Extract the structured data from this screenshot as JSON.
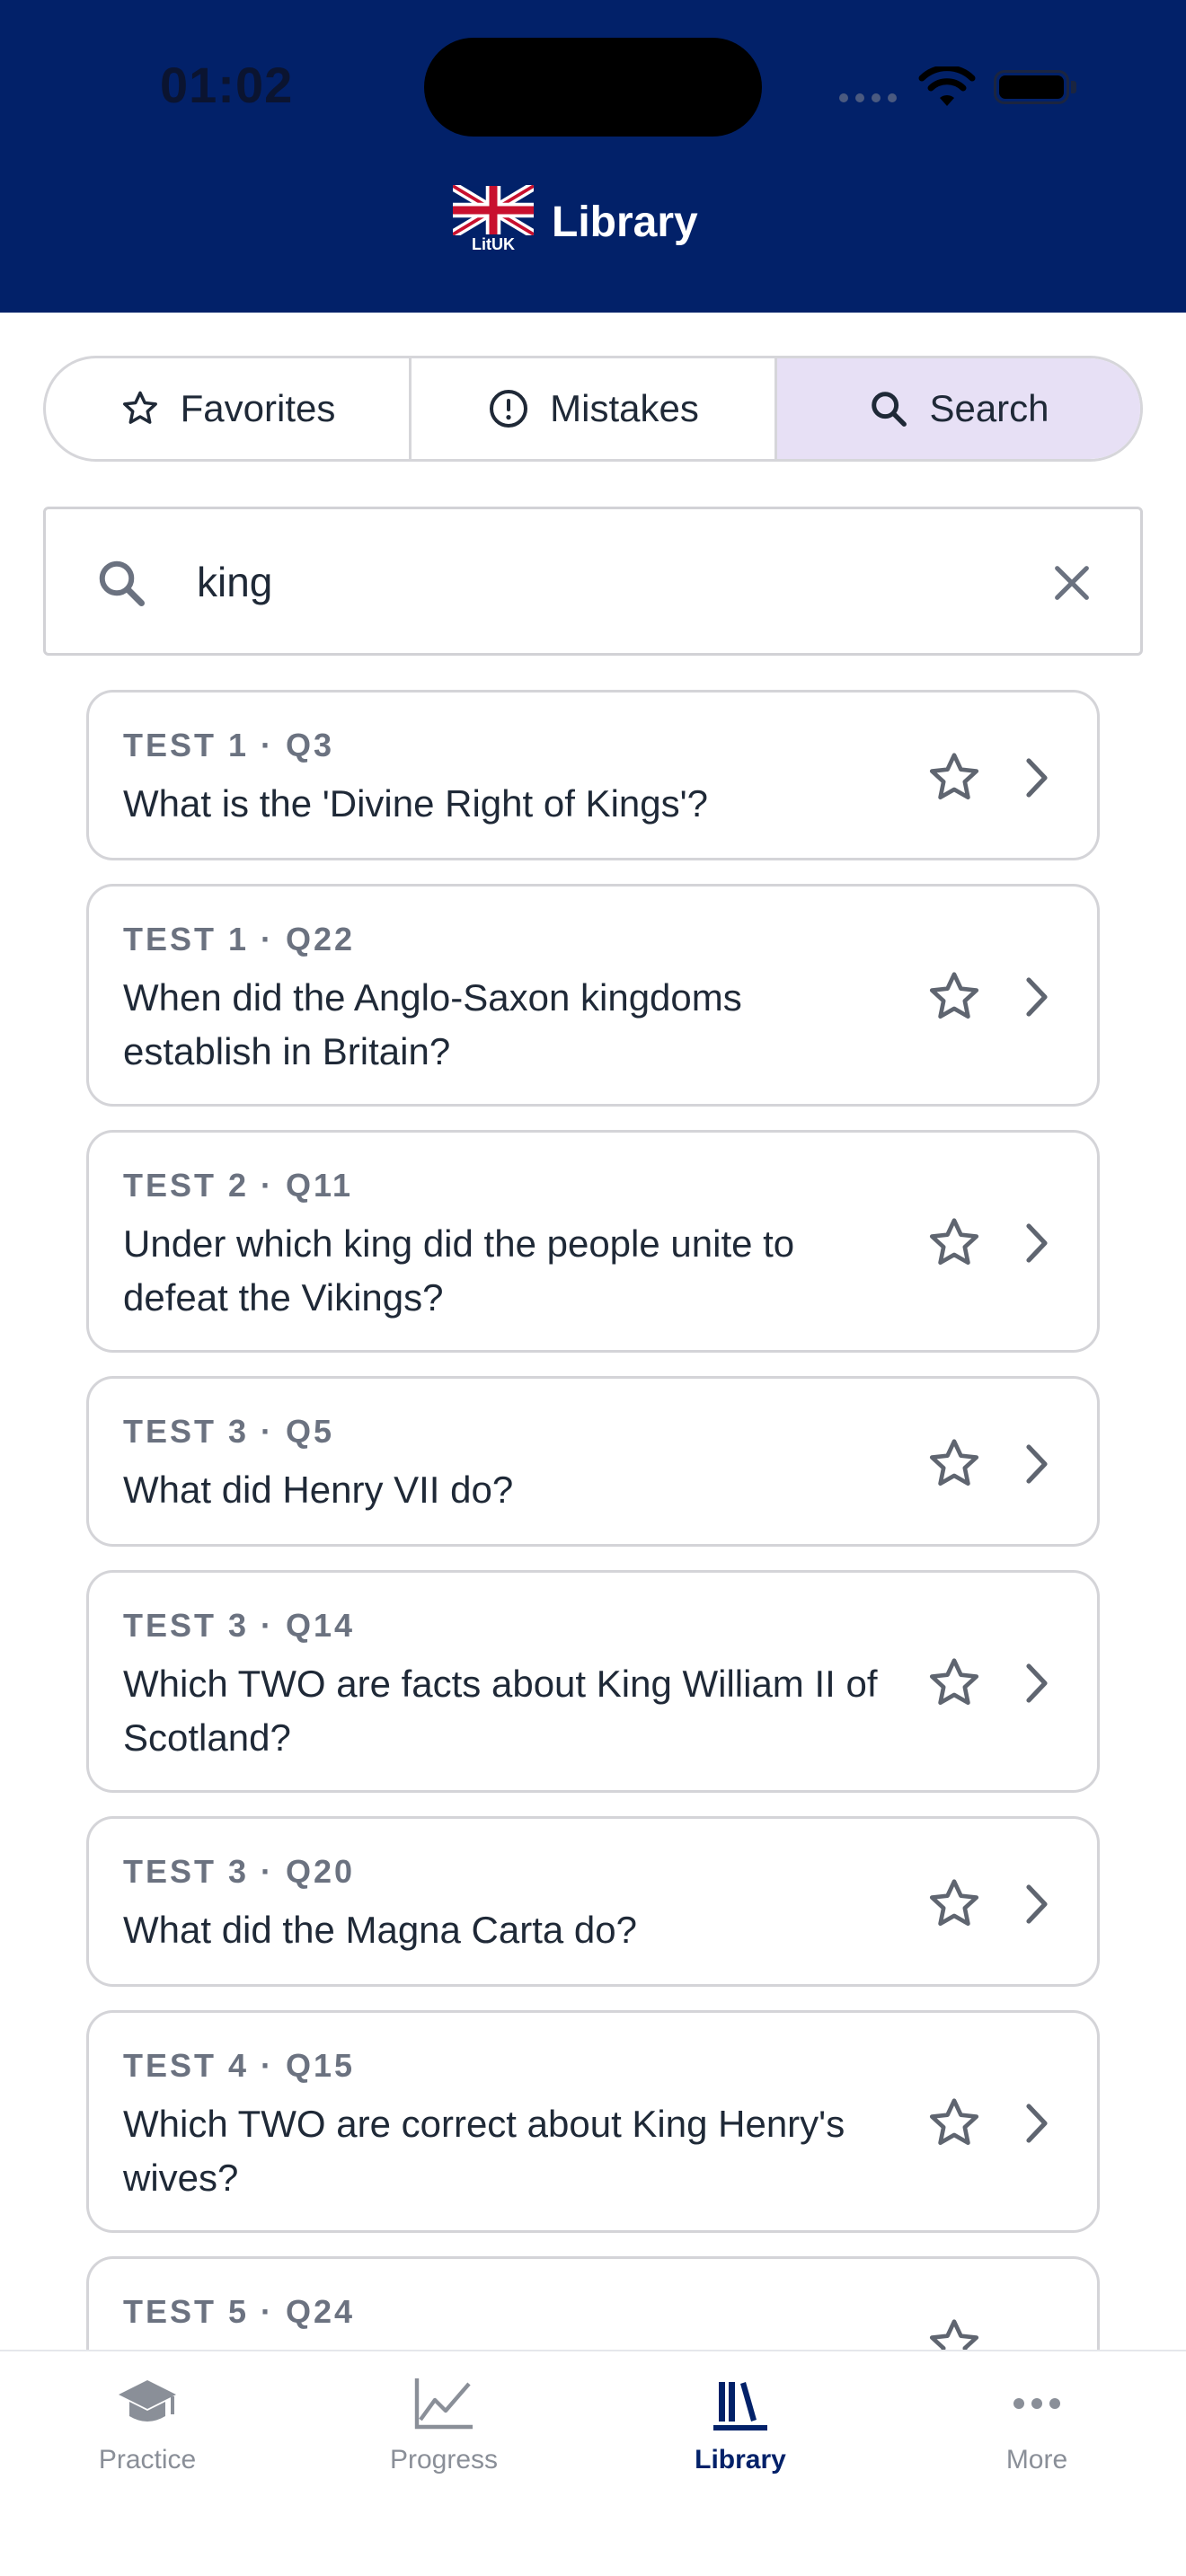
{
  "status_bar": {
    "time": "01:02"
  },
  "header": {
    "brand_text": "LitUK",
    "title": "Library"
  },
  "segments": [
    {
      "label": "Favorites",
      "icon": "star-icon",
      "active": false
    },
    {
      "label": "Mistakes",
      "icon": "alert-circle-icon",
      "active": false
    },
    {
      "label": "Search",
      "icon": "search-icon",
      "active": true
    }
  ],
  "search": {
    "value": "king",
    "placeholder": ""
  },
  "results": [
    {
      "label": "TEST 1 · Q3",
      "question": "What is the 'Divine Right of Kings'?"
    },
    {
      "label": "TEST 1 · Q22",
      "question": "When did the Anglo-Saxon kingdoms establish in Britain?"
    },
    {
      "label": "TEST 2 · Q11",
      "question": "Under which king did the people unite to defeat the Vikings?"
    },
    {
      "label": "TEST 3 · Q5",
      "question": "What did Henry VII do?"
    },
    {
      "label": "TEST 3 · Q14",
      "question": "Which TWO are facts about King William II of Scotland?"
    },
    {
      "label": "TEST 3 · Q20",
      "question": "What did the Magna Carta do?"
    },
    {
      "label": "TEST 4 · Q15",
      "question": "Which TWO are correct about King Henry's wives?"
    },
    {
      "label": "TEST 5 · Q24",
      "question": ""
    }
  ],
  "tabs": [
    {
      "label": "Practice",
      "icon": "graduation-cap-icon",
      "active": false
    },
    {
      "label": "Progress",
      "icon": "chart-line-icon",
      "active": false
    },
    {
      "label": "Library",
      "icon": "books-icon",
      "active": true
    },
    {
      "label": "More",
      "icon": "more-dots-icon",
      "active": false
    }
  ],
  "colors": {
    "header": "#022169",
    "active_segment": "#e7e0f5",
    "active_tab": "#022169"
  }
}
